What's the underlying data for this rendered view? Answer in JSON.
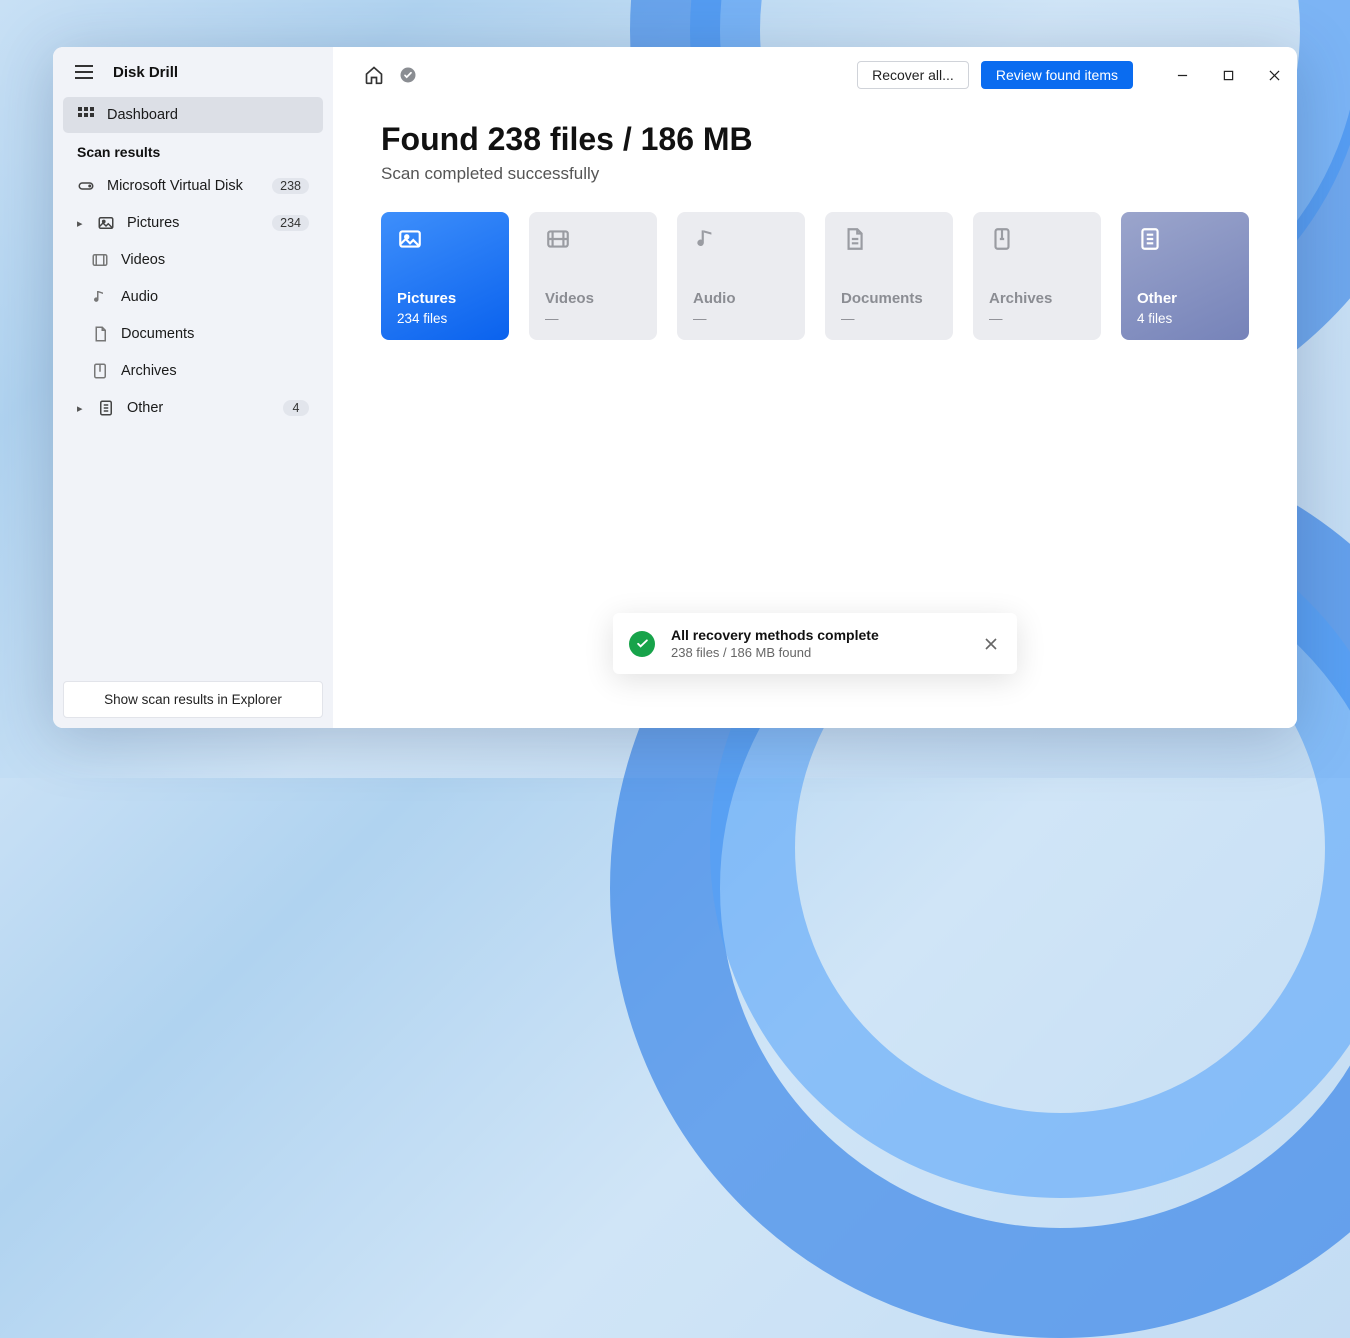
{
  "app_title": "Disk Drill",
  "sidebar": {
    "dashboard": "Dashboard",
    "section_label": "Scan results",
    "disk": {
      "label": "Microsoft Virtual Disk",
      "count": "238"
    },
    "pictures": {
      "label": "Pictures",
      "count": "234"
    },
    "videos": "Videos",
    "audio": "Audio",
    "documents": "Documents",
    "archives": "Archives",
    "other": {
      "label": "Other",
      "count": "4"
    },
    "explorer_btn": "Show scan results in Explorer"
  },
  "toolbar": {
    "recover_all": "Recover all...",
    "review": "Review found items"
  },
  "main": {
    "heading": "Found 238 files / 186 MB",
    "subtitle": "Scan completed successfully"
  },
  "cards": {
    "pictures": {
      "title": "Pictures",
      "count": "234 files"
    },
    "videos": {
      "title": "Videos",
      "count": "—"
    },
    "audio": {
      "title": "Audio",
      "count": "—"
    },
    "documents": {
      "title": "Documents",
      "count": "—"
    },
    "archives": {
      "title": "Archives",
      "count": "—"
    },
    "other": {
      "title": "Other",
      "count": "4 files"
    }
  },
  "toast": {
    "title": "All recovery methods complete",
    "sub": "238 files / 186 MB found"
  }
}
